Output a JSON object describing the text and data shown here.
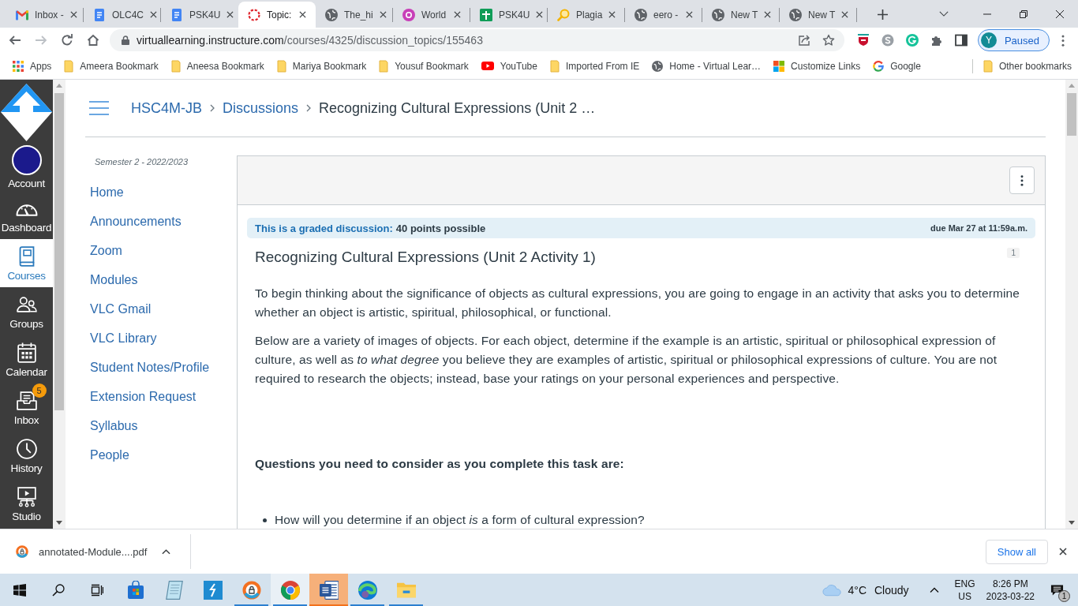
{
  "browser": {
    "tabs": [
      {
        "title": "Inbox -",
        "kind": "mail",
        "selected": false
      },
      {
        "title": "OLC4C",
        "kind": "doc",
        "selected": false
      },
      {
        "title": "PSK4U",
        "kind": "doc",
        "selected": false
      },
      {
        "title": "Topic:",
        "kind": "ring",
        "selected": true
      },
      {
        "title": "The_hi",
        "kind": "globe",
        "selected": false
      },
      {
        "title": "World",
        "kind": "circle",
        "selected": false
      },
      {
        "title": "PSK4U",
        "kind": "sheet",
        "selected": false
      },
      {
        "title": "Plagia",
        "kind": "magnifier",
        "selected": false
      },
      {
        "title": "eero -",
        "kind": "globe",
        "selected": false
      },
      {
        "title": "New T",
        "kind": "globe",
        "selected": false
      },
      {
        "title": "New T",
        "kind": "globe",
        "selected": false
      }
    ],
    "can_go_forward": false,
    "address": {
      "host": "virtuallearning.instructure.com",
      "path": "/courses/4325/discussion_topics/155463"
    },
    "profile": {
      "initial": "Y",
      "status": "Paused"
    },
    "bookmarks": [
      {
        "label": "Apps",
        "kind": "apps"
      },
      {
        "label": "Ameera Bookmark",
        "kind": "folder"
      },
      {
        "label": "Aneesa Bookmark",
        "kind": "folder"
      },
      {
        "label": "Mariya Bookmark",
        "kind": "folder"
      },
      {
        "label": "Yousuf Bookmark",
        "kind": "folder"
      },
      {
        "label": "YouTube",
        "kind": "youtube"
      },
      {
        "label": "Imported From IE",
        "kind": "folder"
      },
      {
        "label": "Home - Virtual Lear…",
        "kind": "site"
      },
      {
        "label": "Customize Links",
        "kind": "microsoft"
      },
      {
        "label": "Google",
        "kind": "google"
      }
    ],
    "other_bookmarks": "Other bookmarks"
  },
  "global_nav": {
    "items": [
      {
        "label": "Account",
        "kind": "avatar",
        "selected": false
      },
      {
        "label": "Dashboard",
        "kind": "gauge",
        "selected": false
      },
      {
        "label": "Courses",
        "kind": "book",
        "selected": true
      },
      {
        "label": "Groups",
        "kind": "people",
        "selected": false
      },
      {
        "label": "Calendar",
        "kind": "calendar",
        "selected": false
      },
      {
        "label": "Inbox",
        "kind": "inbox",
        "selected": false,
        "badge": "5"
      },
      {
        "label": "History",
        "kind": "clock",
        "selected": false
      },
      {
        "label": "Studio",
        "kind": "monitor",
        "selected": false
      }
    ]
  },
  "breadcrumbs": [
    "HSC4M-JB",
    "Discussions",
    "Recognizing Cultural Expressions (Unit 2 …"
  ],
  "course_nav": {
    "term": "Semester 2 - 2022/2023",
    "items": [
      "Home",
      "Announcements",
      "Zoom",
      "Modules",
      "VLC Gmail",
      "VLC Library",
      "Student Notes/Profile",
      "Extension Request",
      "Syllabus",
      "People"
    ]
  },
  "discussion": {
    "graded_label": "This is a graded discussion:",
    "points": "40 points possible",
    "due": "due Mar 27 at 11:59a.m.",
    "title": "Recognizing Cultural Expressions (Unit 2 Activity 1)",
    "reply_count": "1",
    "paragraphs": [
      "To begin thinking about the significance of objects as cultural expressions, you are going to engage in an activity that asks you to determine whether an object is artistic, spiritual, philosophical, or functional.",
      "Below are a variety of images of objects. For each object, determine if the example is an artistic, spiritual or philosophical expression of culture, as well as *to what degree* you believe they are examples of artistic, spiritual or philosophical expressions of culture. You are not required to research the objects; instead, base your ratings on your personal experiences and perspective."
    ],
    "questions_heading": "Questions you need to consider as you complete this task are:",
    "questions": [
      "How will you determine if an object *is* a form of cultural expression?"
    ]
  },
  "download_bar": {
    "file": "annotated-Module....pdf",
    "show_all": "Show all"
  },
  "taskbar": {
    "apps": [
      {
        "kind": "start",
        "running": false,
        "selected": false,
        "flashing": false
      },
      {
        "kind": "search",
        "running": false,
        "selected": false,
        "flashing": false
      },
      {
        "kind": "taskview",
        "running": false,
        "selected": false,
        "flashing": false
      },
      {
        "kind": "store",
        "running": false,
        "selected": false,
        "flashing": false
      },
      {
        "kind": "notepad",
        "running": false,
        "selected": false,
        "flashing": false
      },
      {
        "kind": "tile",
        "running": false,
        "selected": false,
        "flashing": false
      },
      {
        "kind": "lockbrowser",
        "running": true,
        "selected": false,
        "flashing": false
      },
      {
        "kind": "chrome",
        "running": true,
        "selected": true,
        "flashing": false
      },
      {
        "kind": "word",
        "running": true,
        "selected": false,
        "flashing": true
      },
      {
        "kind": "edge",
        "running": true,
        "selected": false,
        "flashing": false
      },
      {
        "kind": "explorer",
        "running": true,
        "selected": false,
        "flashing": false
      }
    ],
    "weather": {
      "temperature": "4°C",
      "condition": "Cloudy"
    },
    "language": "ENG",
    "region": "US",
    "time": "8:26 PM",
    "date": "2023-03-22",
    "notifications": "1"
  }
}
